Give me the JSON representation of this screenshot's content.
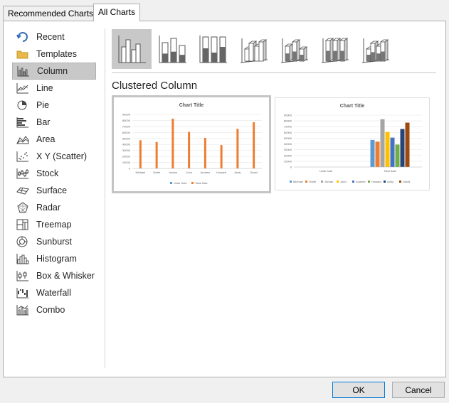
{
  "tabs": [
    {
      "label": "Recommended Charts"
    },
    {
      "label": "All Charts"
    }
  ],
  "nav": [
    {
      "label": "Recent",
      "icon": "recent-icon"
    },
    {
      "label": "Templates",
      "icon": "folder-icon"
    },
    {
      "label": "Column",
      "icon": "column-chart-icon",
      "selected": true
    },
    {
      "label": "Line",
      "icon": "line-chart-icon"
    },
    {
      "label": "Pie",
      "icon": "pie-chart-icon"
    },
    {
      "label": "Bar",
      "icon": "bar-chart-icon"
    },
    {
      "label": "Area",
      "icon": "area-chart-icon"
    },
    {
      "label": "X Y (Scatter)",
      "icon": "scatter-chart-icon"
    },
    {
      "label": "Stock",
      "icon": "stock-chart-icon"
    },
    {
      "label": "Surface",
      "icon": "surface-chart-icon"
    },
    {
      "label": "Radar",
      "icon": "radar-chart-icon"
    },
    {
      "label": "Treemap",
      "icon": "treemap-chart-icon"
    },
    {
      "label": "Sunburst",
      "icon": "sunburst-chart-icon"
    },
    {
      "label": "Histogram",
      "icon": "histogram-chart-icon"
    },
    {
      "label": "Box & Whisker",
      "icon": "box-whisker-chart-icon"
    },
    {
      "label": "Waterfall",
      "icon": "waterfall-chart-icon"
    },
    {
      "label": "Combo",
      "icon": "combo-chart-icon"
    }
  ],
  "subtype_title": "Clustered Column",
  "subtypes": [
    {
      "icon": "clustered-column-icon",
      "selected": true
    },
    {
      "icon": "stacked-column-icon"
    },
    {
      "icon": "100-stacked-column-icon"
    },
    {
      "icon": "3d-clustered-column-icon"
    },
    {
      "icon": "3d-stacked-column-icon"
    },
    {
      "icon": "3d-100-stacked-column-icon"
    },
    {
      "icon": "3d-column-icon"
    }
  ],
  "colors": {
    "orange": "#ed7d31",
    "blue": "#5b9bd5",
    "gray": "#a5a5a5",
    "gold": "#ffc000",
    "darkblue": "#4472c4",
    "green": "#70ad47",
    "navy": "#264478",
    "brown": "#9e480e"
  },
  "chart_data": [
    {
      "type": "bar",
      "title": "Chart Title",
      "categories": [
        "Michael",
        "Smith",
        "Jordan",
        "John",
        "Andrew",
        "Howard",
        "Andy",
        "David"
      ],
      "series": [
        {
          "name": "Units Sold",
          "values": [
            0,
            0,
            0,
            0,
            0,
            0,
            0,
            0
          ]
        },
        {
          "name": "Total Sale",
          "values": [
            47000,
            44000,
            83000,
            61000,
            51000,
            39000,
            66000,
            77000
          ]
        }
      ],
      "y_ticks": [
        "0",
        "10000",
        "20000",
        "30000",
        "40000",
        "50000",
        "60000",
        "70000",
        "80000",
        "90000"
      ],
      "ylim": [
        0,
        90000
      ],
      "legend": "bottom"
    },
    {
      "type": "bar",
      "title": "Chart Title",
      "categories": [
        "Units Sold",
        "Total Sale"
      ],
      "series": [
        {
          "name": "Michael",
          "values": [
            0,
            47000
          ]
        },
        {
          "name": "Smith",
          "values": [
            0,
            44000
          ]
        },
        {
          "name": "Jordan",
          "values": [
            0,
            83000
          ]
        },
        {
          "name": "John",
          "values": [
            0,
            61000
          ]
        },
        {
          "name": "Andrew",
          "values": [
            0,
            51000
          ]
        },
        {
          "name": "Howard",
          "values": [
            0,
            39000
          ]
        },
        {
          "name": "Andy",
          "values": [
            0,
            66000
          ]
        },
        {
          "name": "David",
          "values": [
            0,
            77000
          ]
        }
      ],
      "y_ticks": [
        "0",
        "10000",
        "20000",
        "30000",
        "40000",
        "50000",
        "60000",
        "70000",
        "80000",
        "90000"
      ],
      "ylim": [
        0,
        90000
      ],
      "legend": "bottom"
    }
  ],
  "buttons": {
    "ok": "OK",
    "cancel": "Cancel"
  }
}
